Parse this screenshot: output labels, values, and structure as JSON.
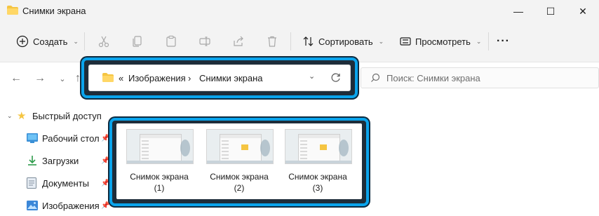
{
  "window": {
    "title": "Снимки экрана",
    "controls": {
      "minimize": "—",
      "maximize": "☐",
      "close": "✕"
    }
  },
  "toolbar": {
    "create_label": "Создать",
    "sort_label": "Сортировать",
    "view_label": "Просмотреть",
    "more_label": "···",
    "icons": [
      "cut-icon",
      "copy-icon",
      "paste-icon",
      "rename-icon",
      "share-icon",
      "delete-icon"
    ]
  },
  "address": {
    "prefix": "«",
    "segments": [
      "Изображения",
      "Снимки экрана"
    ],
    "separator": "›"
  },
  "search": {
    "placeholder": "Поиск: Снимки экрана"
  },
  "sidebar": {
    "items": [
      {
        "label": "Быстрый доступ",
        "icon": "star-icon"
      },
      {
        "label": "Рабочий стол",
        "icon": "desktop-icon"
      },
      {
        "label": "Загрузки",
        "icon": "download-icon"
      },
      {
        "label": "Документы",
        "icon": "document-icon"
      },
      {
        "label": "Изображения",
        "icon": "pictures-icon"
      }
    ]
  },
  "files": [
    {
      "line1": "Снимок экрана",
      "line2": "(1)"
    },
    {
      "line1": "Снимок экрана",
      "line2": "(2)"
    },
    {
      "line1": "Снимок экрана",
      "line2": "(3)"
    }
  ],
  "colors": {
    "highlight": "#0aa4ec",
    "folder": "#f5c542",
    "accent": "#0067c0"
  }
}
